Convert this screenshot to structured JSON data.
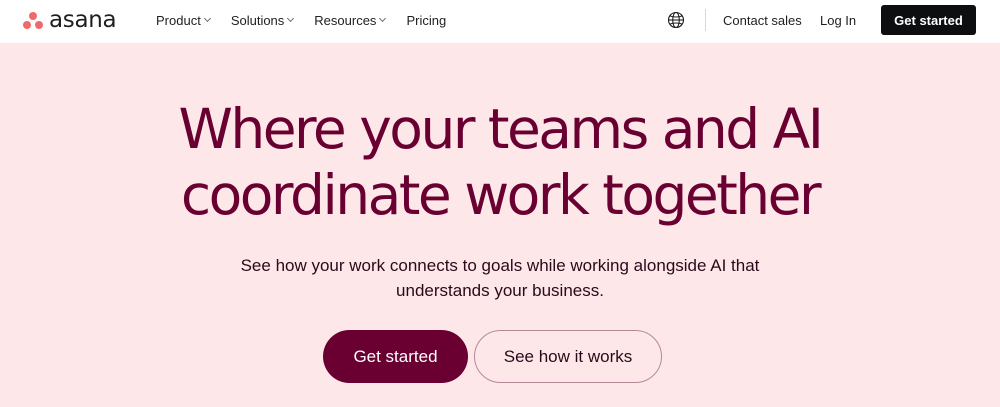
{
  "brand": {
    "logo_text": "asana",
    "logo_color": "#f06a6a"
  },
  "nav": {
    "items": [
      {
        "label": "Product",
        "dropdown": true
      },
      {
        "label": "Solutions",
        "dropdown": true
      },
      {
        "label": "Resources",
        "dropdown": true
      },
      {
        "label": "Pricing",
        "dropdown": false
      }
    ],
    "language_icon": "globe-icon",
    "contact_label": "Contact sales",
    "login_label": "Log In",
    "get_started_label": "Get started"
  },
  "hero": {
    "headline_line1": "Where your teams and AI",
    "headline_line2": "coordinate work together",
    "subtitle_line1": "See how your work connects to goals while working alongside AI that",
    "subtitle_line2": "understands your business.",
    "primary_cta": "Get started",
    "secondary_cta": "See how it works",
    "background": "#fde7e8",
    "accent": "#690031"
  }
}
